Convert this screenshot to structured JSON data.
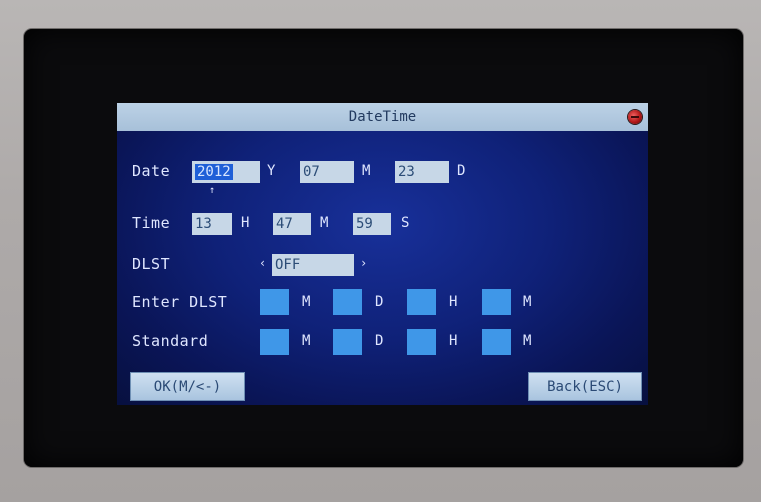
{
  "window": {
    "title": "DateTime"
  },
  "date": {
    "label": "Date",
    "year": "2012",
    "year_unit": "Y",
    "month": "07",
    "month_unit": "M",
    "day": "23",
    "day_unit": "D",
    "cursor_mark": "↑"
  },
  "time": {
    "label": "Time",
    "hour": "13",
    "hour_unit": "H",
    "minute": "47",
    "minute_unit": "M",
    "second": "59",
    "second_unit": "S"
  },
  "dlst": {
    "label": "DLST",
    "value": "OFF",
    "left_arrow": "‹",
    "right_arrow": "›"
  },
  "enter_dlst": {
    "label": "Enter DLST",
    "units": [
      "M",
      "D",
      "H",
      "M"
    ]
  },
  "standard": {
    "label": "Standard",
    "units": [
      "M",
      "D",
      "H",
      "M"
    ]
  },
  "buttons": {
    "ok": "OK(M/<-)",
    "back": "Back(ESC)"
  },
  "colors": {
    "screen": "#0f2178",
    "titlebar": "#a7c0d9",
    "field": "#c7d7e7",
    "empty_field": "#3f97e8",
    "selection": "#1f5fd7",
    "close": "#b21818"
  }
}
